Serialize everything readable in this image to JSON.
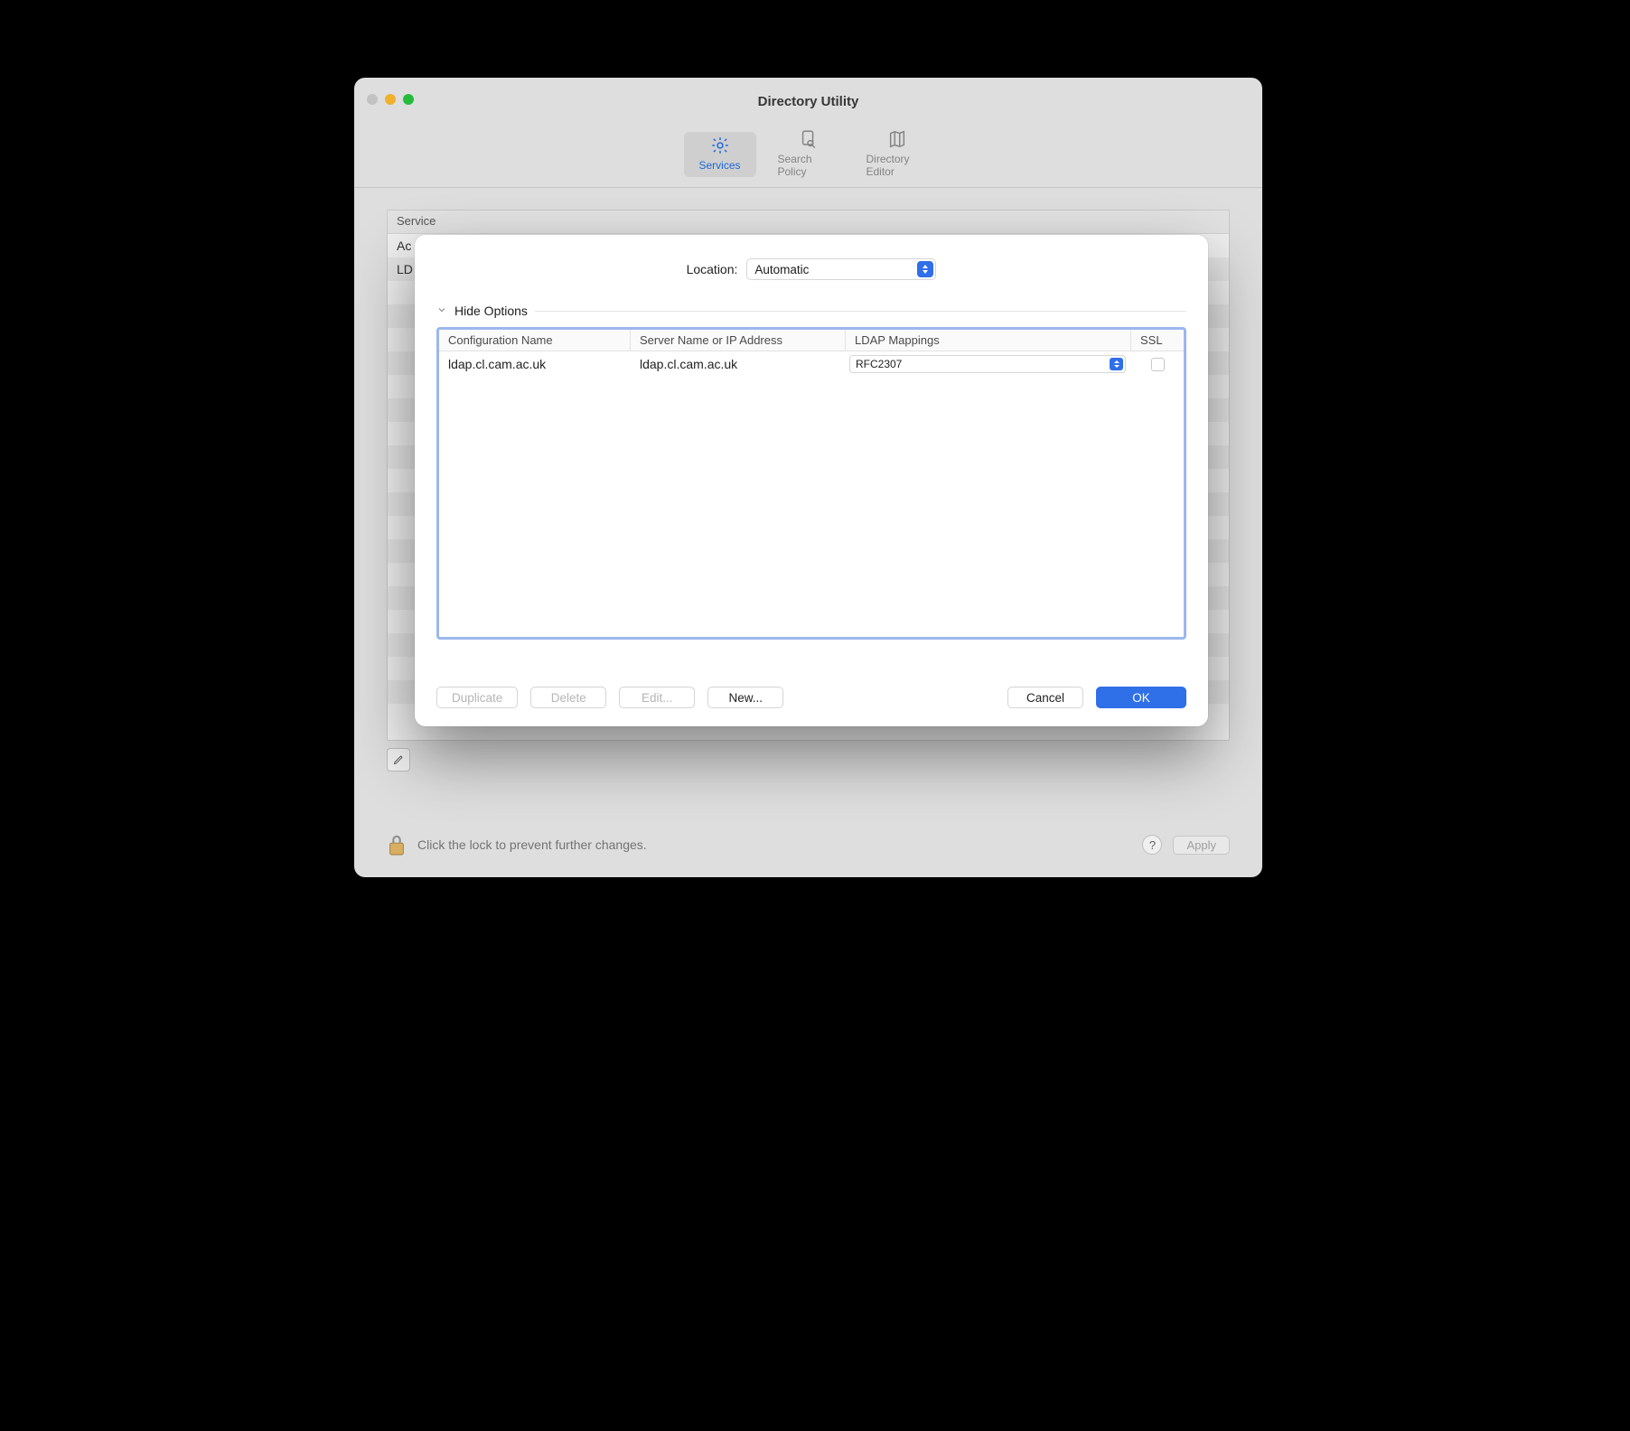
{
  "window": {
    "title": "Directory Utility",
    "toolbar": {
      "services": "Services",
      "search_policy": "Search Policy",
      "directory_editor": "Directory Editor"
    }
  },
  "service_list": {
    "header": "Service",
    "rows": [
      "Ac",
      "LD"
    ]
  },
  "footer": {
    "lock_hint": "Click the lock to prevent further changes.",
    "help": "?",
    "apply": "Apply"
  },
  "sheet": {
    "location_label": "Location:",
    "location_value": "Automatic",
    "hide_options": "Hide Options",
    "columns": {
      "name": "Configuration Name",
      "server": "Server Name or IP Address",
      "mappings": "LDAP Mappings",
      "ssl": "SSL"
    },
    "rows": [
      {
        "name": "ldap.cl.cam.ac.uk",
        "server": "ldap.cl.cam.ac.uk",
        "mapping": "RFC2307",
        "ssl": false
      }
    ],
    "buttons": {
      "duplicate": "Duplicate",
      "delete": "Delete",
      "edit": "Edit...",
      "new": "New...",
      "cancel": "Cancel",
      "ok": "OK"
    }
  }
}
